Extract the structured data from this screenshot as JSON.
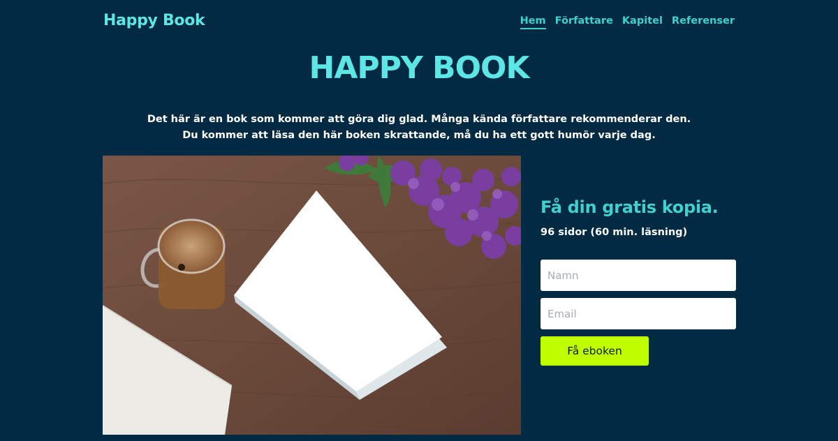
{
  "brand": {
    "logo_text": "Happy Book"
  },
  "nav": {
    "items": [
      {
        "label": "Hem",
        "active": true
      },
      {
        "label": "Författare",
        "active": false
      },
      {
        "label": "Kapitel",
        "active": false
      },
      {
        "label": "Referenser",
        "active": false
      }
    ]
  },
  "hero": {
    "title": "HAPPY BOOK",
    "intro_line1": "Det här är en bok som kommer att göra dig glad. Många kända författare rekommenderar den.",
    "intro_line2": "Du kommer att läsa den här boken skrattande, må du ha ett gott humör varje dag."
  },
  "signup": {
    "title": "Få din gratis kopia.",
    "subtitle": "96 sidor (60 min. läsning)",
    "name_placeholder": "Namn",
    "email_placeholder": "Email",
    "button_label": "Få eboken"
  },
  "colors": {
    "background": "#022a42",
    "accent": "#5ce6e6",
    "nav_link": "#3fd0d0",
    "button": "#bfff00"
  },
  "image": {
    "subject": "book-with-coffee-and-lilacs-photo"
  }
}
